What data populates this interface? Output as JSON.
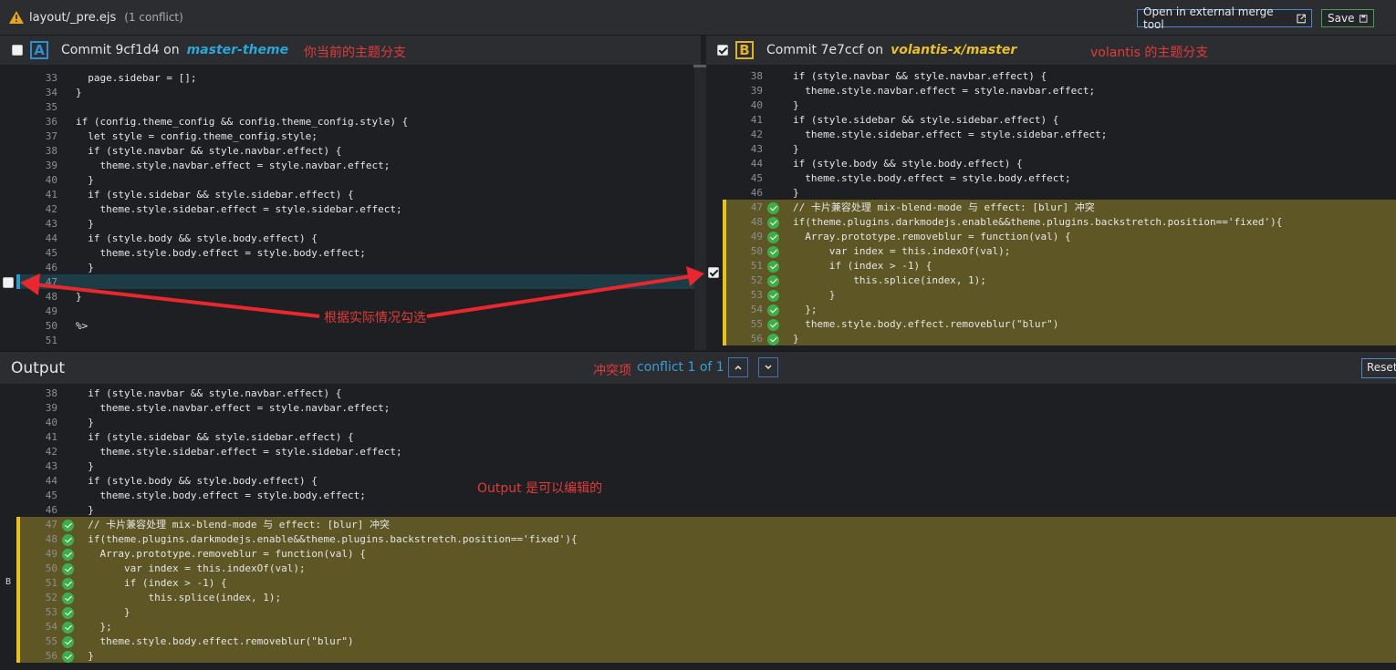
{
  "titlebar": {
    "filename": "layout/_pre.ejs",
    "conflict_count": "(1 conflict)",
    "external_button": "Open in external merge tool",
    "save_button": "Save"
  },
  "pane_a": {
    "letter": "A",
    "commit": "Commit 9cf1d4 on",
    "branch": "master-theme",
    "annotation": "你当前的主题分支",
    "lines": [
      {
        "n": "33",
        "code": "  page.sidebar = [];"
      },
      {
        "n": "34",
        "code": "}"
      },
      {
        "n": "35",
        "code": ""
      },
      {
        "n": "36",
        "code": "if (config.theme_config && config.theme_config.style) {"
      },
      {
        "n": "37",
        "code": "  let style = config.theme_config.style;"
      },
      {
        "n": "38",
        "code": "  if (style.navbar && style.navbar.effect) {"
      },
      {
        "n": "39",
        "code": "    theme.style.navbar.effect = style.navbar.effect;"
      },
      {
        "n": "40",
        "code": "  }"
      },
      {
        "n": "41",
        "code": "  if (style.sidebar && style.sidebar.effect) {"
      },
      {
        "n": "42",
        "code": "    theme.style.sidebar.effect = style.sidebar.effect;"
      },
      {
        "n": "43",
        "code": "  }"
      },
      {
        "n": "44",
        "code": "  if (style.body && style.body.effect) {"
      },
      {
        "n": "45",
        "code": "    theme.style.body.effect = style.body.effect;"
      },
      {
        "n": "46",
        "code": "  }"
      },
      {
        "n": "47",
        "code": ""
      },
      {
        "n": "48",
        "code": "}"
      },
      {
        "n": "49",
        "code": ""
      },
      {
        "n": "50",
        "code": "%>"
      },
      {
        "n": "51",
        "code": ""
      }
    ]
  },
  "pane_b": {
    "letter": "B",
    "commit": "Commit 7e7ccf on",
    "branch": "volantis-x/master",
    "annotation": "volantis 的主题分支",
    "lines": [
      {
        "n": "38",
        "code": "if (style.navbar && style.navbar.effect) {"
      },
      {
        "n": "39",
        "code": "  theme.style.navbar.effect = style.navbar.effect;"
      },
      {
        "n": "40",
        "code": "}"
      },
      {
        "n": "41",
        "code": "if (style.sidebar && style.sidebar.effect) {"
      },
      {
        "n": "42",
        "code": "  theme.style.sidebar.effect = style.sidebar.effect;"
      },
      {
        "n": "43",
        "code": "}"
      },
      {
        "n": "44",
        "code": "if (style.body && style.body.effect) {"
      },
      {
        "n": "45",
        "code": "  theme.style.body.effect = style.body.effect;"
      },
      {
        "n": "46",
        "code": "}"
      },
      {
        "n": "47",
        "code": "// 卡片兼容处理 mix-blend-mode 与 effect: [blur] 冲突"
      },
      {
        "n": "48",
        "code": "if(theme.plugins.darkmodejs.enable&&theme.plugins.backstretch.position=='fixed'){"
      },
      {
        "n": "49",
        "code": "  Array.prototype.removeblur = function(val) {"
      },
      {
        "n": "50",
        "code": "      var index = this.indexOf(val);"
      },
      {
        "n": "51",
        "code": "      if (index > -1) {"
      },
      {
        "n": "52",
        "code": "          this.splice(index, 1);"
      },
      {
        "n": "53",
        "code": "      }"
      },
      {
        "n": "54",
        "code": "  };"
      },
      {
        "n": "55",
        "code": "  theme.style.body.effect.removeblur(\"blur\")"
      },
      {
        "n": "56",
        "code": "}"
      }
    ]
  },
  "middle_annotation": "根据实际情况勾选",
  "output": {
    "title": "Output",
    "conflict_annotation": "冲突项",
    "conflict_nav": "conflict 1 of 1",
    "reset_button": "Reset",
    "edit_annotation": "Output 是可以编辑的",
    "side_marker": "B",
    "lines": [
      {
        "n": "38",
        "code": "  if (style.navbar && style.navbar.effect) {"
      },
      {
        "n": "39",
        "code": "    theme.style.navbar.effect = style.navbar.effect;"
      },
      {
        "n": "40",
        "code": "  }"
      },
      {
        "n": "41",
        "code": "  if (style.sidebar && style.sidebar.effect) {"
      },
      {
        "n": "42",
        "code": "    theme.style.sidebar.effect = style.sidebar.effect;"
      },
      {
        "n": "43",
        "code": "  }"
      },
      {
        "n": "44",
        "code": "  if (style.body && style.body.effect) {"
      },
      {
        "n": "45",
        "code": "    theme.style.body.effect = style.body.effect;"
      },
      {
        "n": "46",
        "code": "  }"
      },
      {
        "n": "47",
        "code": "  // 卡片兼容处理 mix-blend-mode 与 effect: [blur] 冲突"
      },
      {
        "n": "48",
        "code": "  if(theme.plugins.darkmodejs.enable&&theme.plugins.backstretch.position=='fixed'){"
      },
      {
        "n": "49",
        "code": "    Array.prototype.removeblur = function(val) {"
      },
      {
        "n": "50",
        "code": "        var index = this.indexOf(val);"
      },
      {
        "n": "51",
        "code": "        if (index > -1) {"
      },
      {
        "n": "52",
        "code": "            this.splice(index, 1);"
      },
      {
        "n": "53",
        "code": "        }"
      },
      {
        "n": "54",
        "code": "    };"
      },
      {
        "n": "55",
        "code": "    theme.style.body.effect.removeblur(\"blur\")"
      },
      {
        "n": "56",
        "code": "  }"
      }
    ]
  },
  "colors": {
    "accent_blue": "#2e8fd0",
    "accent_yellow": "#e0b22a",
    "highlight": "#5e5625",
    "annotation_red": "#e23b3b",
    "resolved_green": "#3fae4a"
  }
}
